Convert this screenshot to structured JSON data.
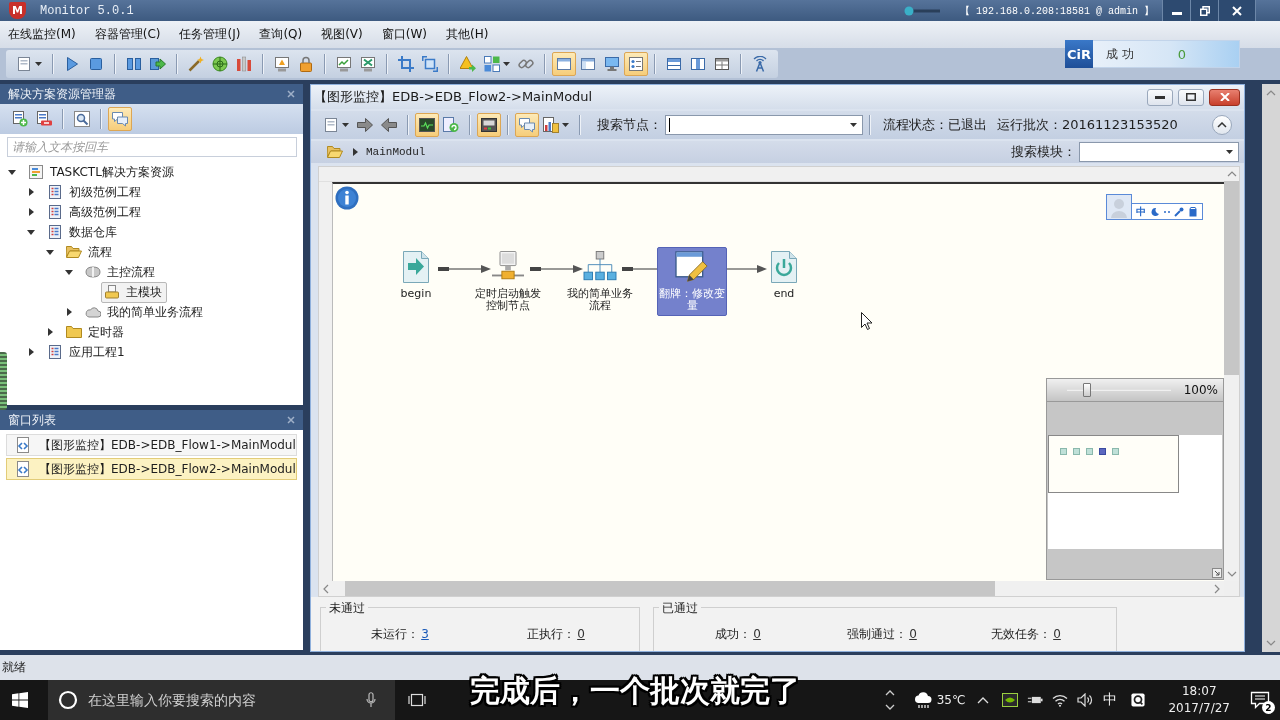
{
  "title_bar": {
    "logo": "M",
    "title": "Monitor 5.0.1",
    "connection": "【 192.168.0.208:18581 @ admin 】"
  },
  "menu": [
    "在线监控(M)",
    "容器管理(C)",
    "任务管理(J)",
    "查询(Q)",
    "视图(V)",
    "窗口(W)",
    "其他(H)"
  ],
  "toolbar": [
    [
      {
        "kind": "page",
        "on": false,
        "dropdown": true
      }
    ],
    [
      {
        "kind": "play",
        "on": false
      },
      {
        "kind": "stop",
        "on": false
      }
    ],
    [
      {
        "kind": "pause",
        "on": false
      },
      {
        "kind": "export",
        "on": false
      }
    ],
    [
      {
        "kind": "wand",
        "on": false
      },
      {
        "kind": "target",
        "on": false
      },
      {
        "kind": "bars",
        "on": false
      }
    ],
    [
      {
        "kind": "alert-screen",
        "on": false
      },
      {
        "kind": "lock",
        "on": false
      }
    ],
    [
      {
        "kind": "chart-screen",
        "on": false
      },
      {
        "kind": "cross-screen",
        "on": false
      }
    ],
    [
      {
        "kind": "crop",
        "on": false
      },
      {
        "kind": "frame",
        "on": false
      }
    ],
    [
      {
        "kind": "warning",
        "on": false
      },
      {
        "kind": "grid",
        "on": false,
        "dropdown": true
      },
      {
        "kind": "link",
        "on": false
      }
    ],
    [
      {
        "kind": "window",
        "on": true
      },
      {
        "kind": "panel",
        "on": false
      },
      {
        "kind": "monitor",
        "on": false
      },
      {
        "kind": "list",
        "on": true
      }
    ],
    [
      {
        "kind": "rows",
        "on": false
      },
      {
        "kind": "columns",
        "on": false
      },
      {
        "kind": "table",
        "on": false
      }
    ],
    [
      {
        "kind": "antenna",
        "on": false
      }
    ]
  ],
  "status_badge": {
    "logo": "CiR",
    "label": "成 功",
    "count": "0"
  },
  "explorer": {
    "title": "解决方案资源管理器",
    "toolbar": [
      [
        {
          "kind": "add-page",
          "on": false
        },
        {
          "kind": "remove-page",
          "on": false
        }
      ],
      [
        {
          "kind": "search",
          "on": false
        }
      ],
      [
        {
          "kind": "chat",
          "on": true
        }
      ]
    ],
    "search": {
      "placeholder": "请输入文本按回车"
    },
    "tree": [
      {
        "label": "TASKCTL解决方案资源",
        "kind": "solution",
        "expanded": true,
        "selected": false,
        "children": [
          {
            "label": "初级范例工程",
            "kind": "project",
            "expanded": false,
            "selected": false
          },
          {
            "label": "高级范例工程",
            "kind": "project",
            "expanded": false,
            "selected": false
          },
          {
            "label": "数据仓库",
            "kind": "project",
            "expanded": true,
            "selected": false,
            "children": [
              {
                "label": "流程",
                "kind": "folder",
                "expanded": true,
                "selected": false,
                "children": [
                  {
                    "label": "主控流程",
                    "kind": "flow",
                    "expanded": true,
                    "selected": false,
                    "children": [
                      {
                        "label": "主模块",
                        "kind": "module",
                        "selected": true
                      }
                    ]
                  },
                  {
                    "label": "我的简单业务流程",
                    "kind": "subflow",
                    "expanded": false,
                    "selected": false
                  }
                ]
              },
              {
                "label": "定时器",
                "kind": "folder",
                "expanded": false,
                "selected": false
              }
            ]
          },
          {
            "label": "应用工程1",
            "kind": "project",
            "expanded": false,
            "selected": false
          }
        ]
      }
    ]
  },
  "window_list": {
    "title": "窗口列表",
    "items": [
      {
        "label": "【图形监控】EDB->EDB_Flow1->MainModul",
        "selected": false
      },
      {
        "label": "【图形监控】EDB->EDB_Flow2->MainModul",
        "selected": true
      }
    ]
  },
  "document": {
    "title": "【图形监控】EDB->EDB_Flow2->MainModul",
    "toolbar": [
      [
        {
          "kind": "page",
          "on": false,
          "dropdown": true
        },
        {
          "kind": "right-arrow",
          "on": false
        },
        {
          "kind": "left-arrow",
          "on": false
        }
      ],
      [
        {
          "kind": "pulse-screen",
          "on": true
        },
        {
          "kind": "refresh-page",
          "on": false
        }
      ],
      [
        {
          "kind": "console",
          "on": true
        }
      ],
      [
        {
          "kind": "chat",
          "on": true
        },
        {
          "kind": "chart-page",
          "on": false,
          "dropdown": true
        }
      ]
    ],
    "search_node": {
      "label": "搜索节点：",
      "focused": true
    },
    "flow_status": "流程状态：已退出",
    "batch": "运行批次：20161123153520",
    "breadcrumb": "MainModul",
    "search_module": {
      "label": "搜索模块："
    },
    "nodes": [
      {
        "label": "begin",
        "kind": "start",
        "selected": false
      },
      {
        "label": "定时启动触发控制节点",
        "kind": "timer",
        "selected": false
      },
      {
        "label": "我的简单业务流程",
        "kind": "subflow",
        "selected": false
      },
      {
        "label": "翻牌：修改变量",
        "kind": "task",
        "selected": true
      },
      {
        "label": "end",
        "kind": "end",
        "selected": false
      }
    ],
    "ime": {
      "mode": "中"
    },
    "zoom": {
      "level": 0.17,
      "reading": "100%"
    },
    "stats": [
      {
        "title": "未通过",
        "items": [
          {
            "label": "未运行：",
            "value": "3",
            "highlighted": true
          },
          {
            "label": "正执行：",
            "value": "0",
            "highlighted": false
          }
        ]
      },
      {
        "title": "已通过",
        "items": [
          {
            "label": "成功：",
            "value": "0",
            "highlighted": false
          },
          {
            "label": "强制通过：",
            "value": "0",
            "highlighted": false
          },
          {
            "label": "无效任务：",
            "value": "0",
            "highlighted": false
          }
        ]
      }
    ]
  },
  "status_bar": "就绪",
  "taskbar": {
    "search": {
      "placeholder": "在这里输入你要搜索的内容"
    },
    "weather": "35℃",
    "input_mode": "中",
    "time": "18:07",
    "date": "2017/7/27",
    "notifications": "2"
  },
  "subtitle": "完成后，一个批次就完了"
}
